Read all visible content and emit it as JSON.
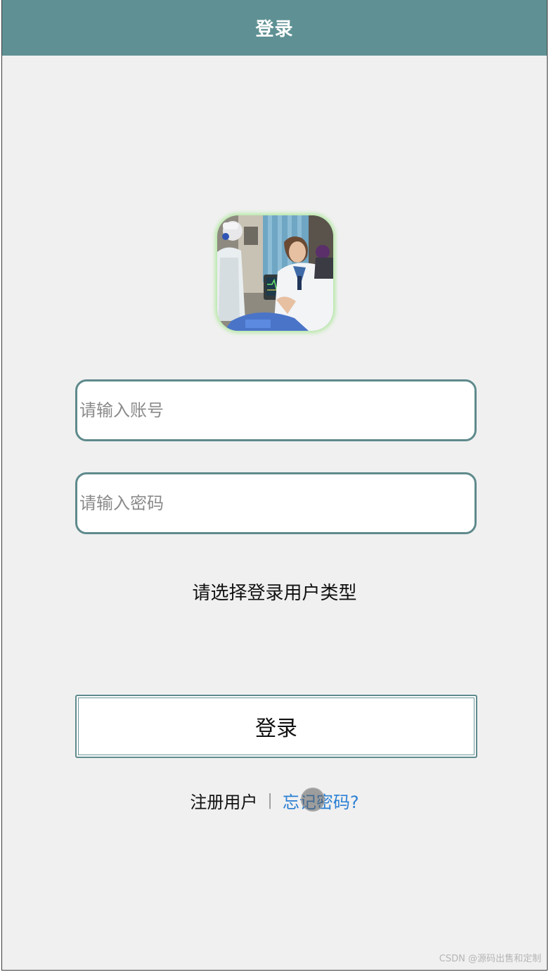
{
  "header": {
    "title": "登录",
    "background_color": "#5f9194"
  },
  "avatar": {
    "icon": "doctor-photo",
    "glow_color": "#b6e9a6"
  },
  "form": {
    "account_placeholder": "请输入账号",
    "account_value": "",
    "password_placeholder": "请输入密码",
    "password_value": "",
    "user_type_prompt": "请选择登录用户类型",
    "login_label": "登录"
  },
  "footer_links": {
    "register_label": "注册用户",
    "separator": "|",
    "forgot_label": "忘记密码?",
    "forgot_color": "#2a7fd4"
  },
  "watermark": {
    "text": "CSDN @源码出售和定制"
  }
}
